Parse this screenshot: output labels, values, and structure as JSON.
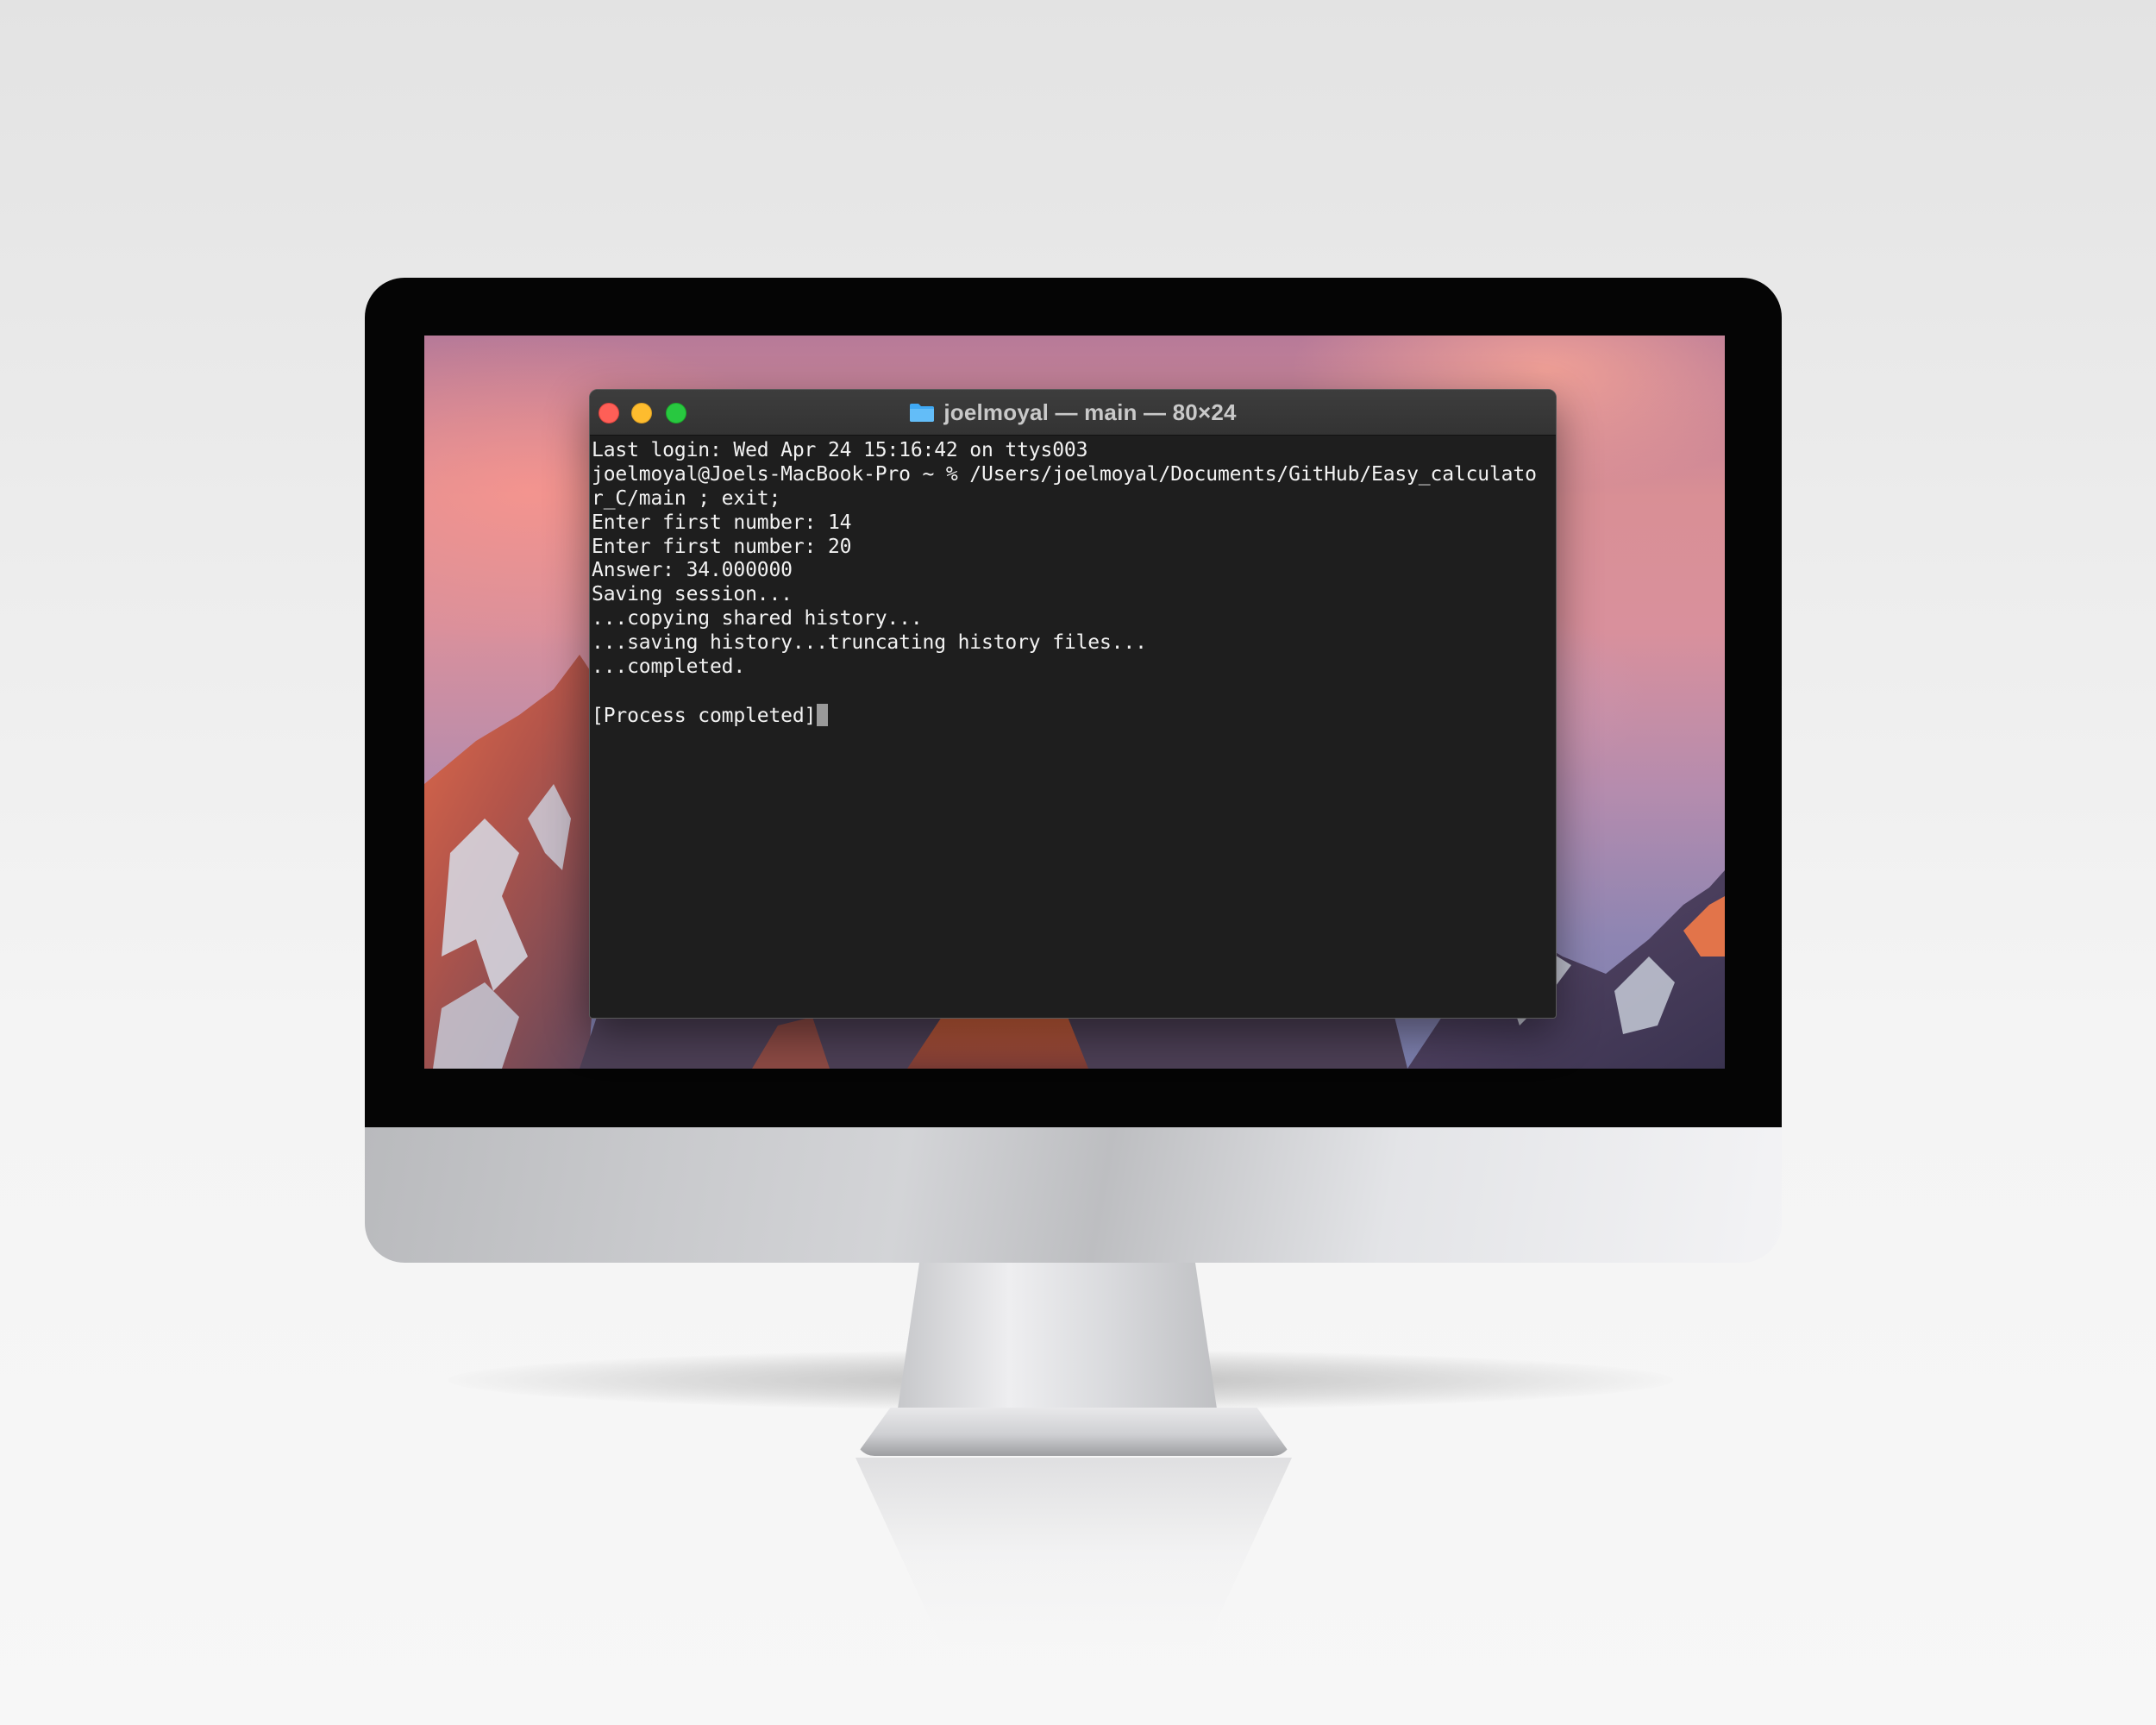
{
  "terminal": {
    "title": "joelmoyal — main — 80×24",
    "lines": [
      "Last login: Wed Apr 24 15:16:42 on ttys003",
      "joelmoyal@Joels-MacBook-Pro ~ % /Users/joelmoyal/Documents/GitHub/Easy_calculato",
      "r_C/main ; exit;",
      "Enter first number: 14",
      "Enter first number: 20",
      "Answer: 34.000000",
      "Saving session...",
      "...copying shared history...",
      "...saving history...truncating history files...",
      "...completed.",
      "",
      "[Process completed]"
    ]
  },
  "colors": {
    "terminal_background": "#1e1e1e",
    "terminal_text": "#f2f2f2",
    "titlebar": "#383838",
    "close_button": "#fe5f57",
    "minimize_button": "#febc2e",
    "zoom_button": "#28c840",
    "folder_icon": "#3fa9f5"
  },
  "icons": {
    "close": "close-icon",
    "minimize": "minimize-icon",
    "zoom": "zoom-icon",
    "folder": "folder-icon"
  }
}
